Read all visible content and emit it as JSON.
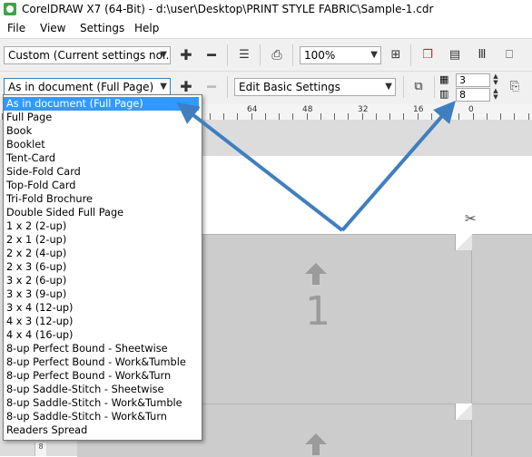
{
  "window": {
    "title": "CorelDRAW X7 (64-Bit) - d:\\user\\Desktop\\PRINT STYLE FABRIC\\Sample-1.cdr"
  },
  "menu": {
    "items": [
      "File",
      "View",
      "Settings",
      "Help"
    ]
  },
  "toolbar1": {
    "preset_value": "Custom (Current settings no...",
    "zoom_value": "100%"
  },
  "toolbar2": {
    "layout_value": "As in document (Full Page)",
    "edit_value": "Edit Basic Settings",
    "rows_value": "3",
    "cols_value": "8"
  },
  "ruler": {
    "labels": [
      "64",
      "48",
      "32",
      "16",
      "0"
    ]
  },
  "canvas": {
    "page_number": "1",
    "vruler_label": "8"
  },
  "layout_dropdown": {
    "selected_index": 0,
    "options": [
      "As in document (Full Page)",
      "Full Page",
      "Book",
      "Booklet",
      "Tent-Card",
      "Side-Fold Card",
      "Top-Fold Card",
      "Tri-Fold Brochure",
      "Double Sided Full Page",
      "1 x 2 (2-up)",
      "2 x 1 (2-up)",
      "2 x 2 (4-up)",
      "2 x 3 (6-up)",
      "3 x 2 (6-up)",
      "3 x 3 (9-up)",
      "3 x 4 (12-up)",
      "4 x 3 (12-up)",
      "4 x 4 (16-up)",
      "8-up Perfect Bound - Sheetwise",
      "8-up Perfect Bound - Work&Tumble",
      "8-up Perfect Bound - Work&Turn",
      "8-up Saddle-Stitch - Sheetwise",
      "8-up Saddle-Stitch - Work&Tumble",
      "8-up Saddle-Stitch - Work&Turn",
      "Readers Spread"
    ]
  },
  "colors": {
    "selection": "#3399ff",
    "annotation_arrow": "#3f7fbf",
    "sheet": "#cccccc"
  },
  "icons": [
    "app-icon",
    "add-icon",
    "remove-icon",
    "checklist-icon",
    "print-icon",
    "fit-page-icon",
    "color-separations-icon",
    "rows-grid-icon",
    "columns-grid-icon",
    "flip-icon",
    "template-icon",
    "scissors-icon"
  ]
}
